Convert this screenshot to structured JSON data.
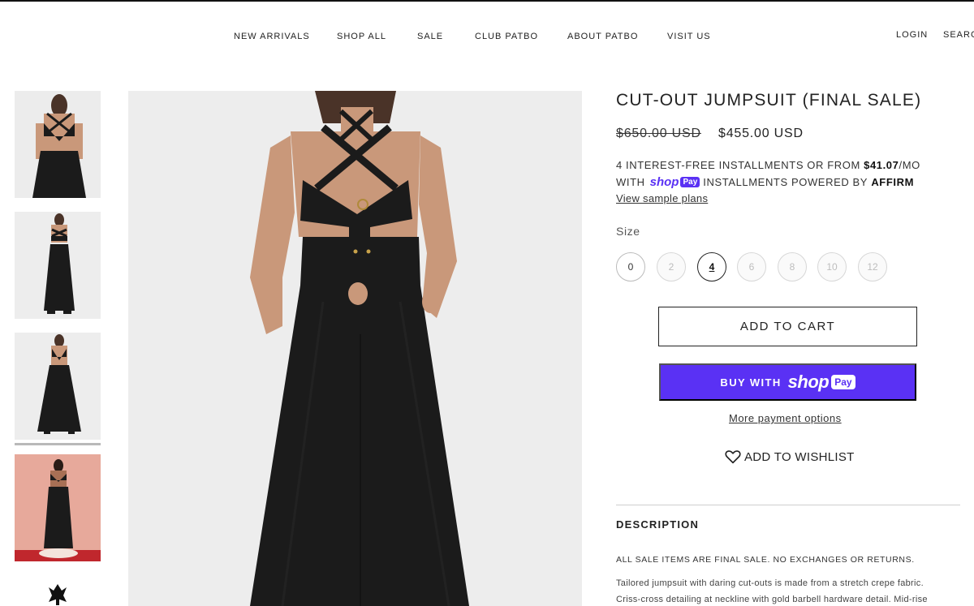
{
  "nav": {
    "items": [
      "NEW ARRIVALS",
      "SHOP ALL",
      "SALE",
      "CLUB PATBO",
      "ABOUT PATBO",
      "VISIT US"
    ],
    "login": "LOGIN",
    "search": "SEARC"
  },
  "product": {
    "title": "CUT-OUT JUMPSUIT (FINAL SALE)",
    "price_old": "$650.00 USD",
    "price_new": "$455.00 USD",
    "installments_line1_pre": "4 INTEREST-FREE INSTALLMENTS OR FROM ",
    "installments_amount": "$41.07",
    "installments_line1_post": "/MO",
    "installments_line2_pre": "WITH",
    "installments_line2_mid": "INSTALLMENTS POWERED BY ",
    "installments_provider": "AFFIRM",
    "shoppay_word": "shop",
    "shoppay_pay": "Pay",
    "sample_plans": "View sample plans",
    "size_label": "Size",
    "sizes": [
      {
        "label": "0",
        "available": true
      },
      {
        "label": "2",
        "available": false
      },
      {
        "label": "4",
        "available": true,
        "selected": true
      },
      {
        "label": "6",
        "available": false
      },
      {
        "label": "8",
        "available": false
      },
      {
        "label": "10",
        "available": false
      },
      {
        "label": "12",
        "available": false
      }
    ],
    "add_to_cart": "ADD TO CART",
    "buy_with": "BUY WITH",
    "more_payment": "More payment options",
    "wishlist": "ADD TO WISHLIST"
  },
  "description": {
    "heading": "DESCRIPTION",
    "sale_note": "ALL SALE ITEMS ARE FINAL SALE.  NO EXCHANGES OR RETURNS.",
    "body_line1": "Tailored jumpsuit with daring cut-outs is made from a stretch crepe fabric.",
    "body_line2": "Criss-cross detailing at neckline with gold barbell hardware detail.  Mid-rise"
  },
  "colors": {
    "shoppay_purple": "#5a31f4",
    "garment": "#1b1b1b",
    "skin": "#c9987a",
    "studio_bg": "#ededed",
    "pink_bg": "#e7a99b"
  },
  "icons": {
    "wishlist": "heart-outline-icon",
    "brand": "patbo-logo-icon"
  }
}
